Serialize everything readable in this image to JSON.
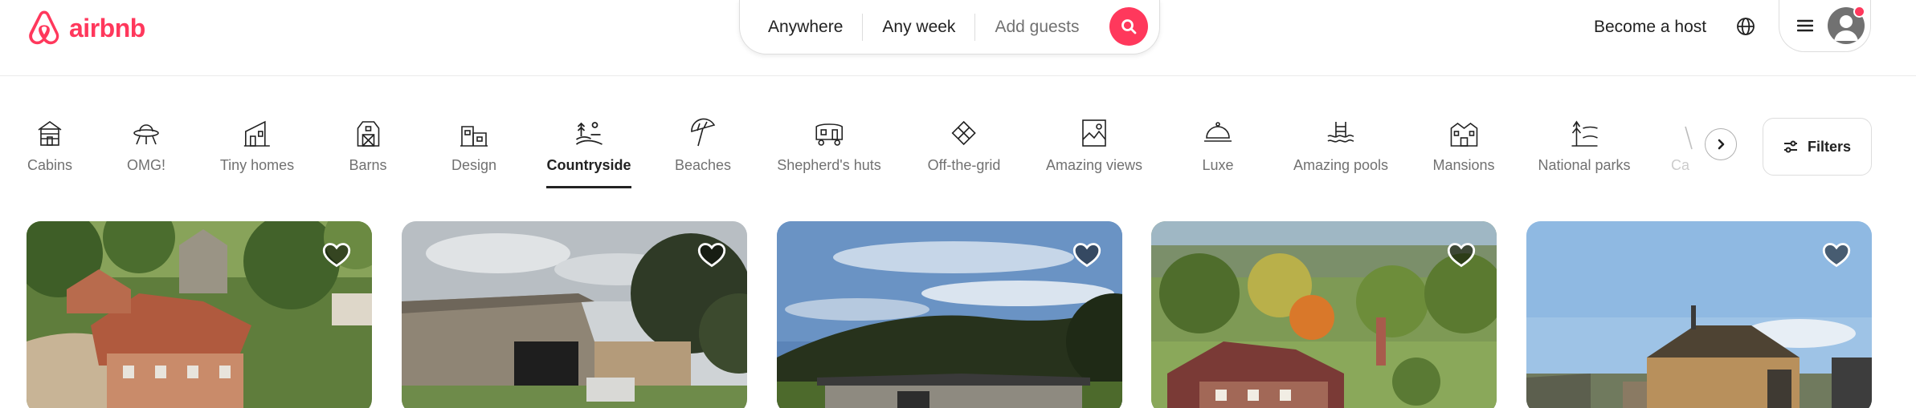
{
  "brand": {
    "name": "airbnb",
    "color": "#FF385C"
  },
  "search": {
    "where": "Anywhere",
    "when": "Any week",
    "who": "Add guests",
    "button_icon": "search-icon"
  },
  "header": {
    "host_link": "Become a host",
    "language_icon": "globe-icon",
    "menu_icon": "hamburger-icon",
    "avatar_icon": "user-avatar-icon",
    "notification": true
  },
  "categories": {
    "items": [
      {
        "label": "Cabins",
        "icon": "cabin-icon"
      },
      {
        "label": "OMG!",
        "icon": "ufo-icon"
      },
      {
        "label": "Tiny homes",
        "icon": "tiny-home-icon"
      },
      {
        "label": "Barns",
        "icon": "barn-icon"
      },
      {
        "label": "Design",
        "icon": "design-icon"
      },
      {
        "label": "Countryside",
        "icon": "countryside-icon",
        "selected": true
      },
      {
        "label": "Beaches",
        "icon": "beach-umbrella-icon"
      },
      {
        "label": "Shepherd's huts",
        "icon": "shepherds-hut-icon"
      },
      {
        "label": "Off-the-grid",
        "icon": "off-grid-icon"
      },
      {
        "label": "Amazing views",
        "icon": "view-icon"
      },
      {
        "label": "Luxe",
        "icon": "luxe-icon"
      },
      {
        "label": "Amazing pools",
        "icon": "pool-icon"
      },
      {
        "label": "Mansions",
        "icon": "mansion-icon"
      },
      {
        "label": "National parks",
        "icon": "national-park-icon"
      }
    ],
    "partial_label": "Ca",
    "next_icon": "chevron-right-icon",
    "filters_label": "Filters",
    "filters_icon": "sliders-icon"
  },
  "listings": [
    {
      "scene": "aerial-manor",
      "wishlisted": false
    },
    {
      "scene": "wooden-barn",
      "wishlisted": false
    },
    {
      "scene": "bungalow-field",
      "wishlisted": false
    },
    {
      "scene": "autumn-farmhouse",
      "wishlisted": false
    },
    {
      "scene": "timber-cabin",
      "wishlisted": false
    }
  ]
}
